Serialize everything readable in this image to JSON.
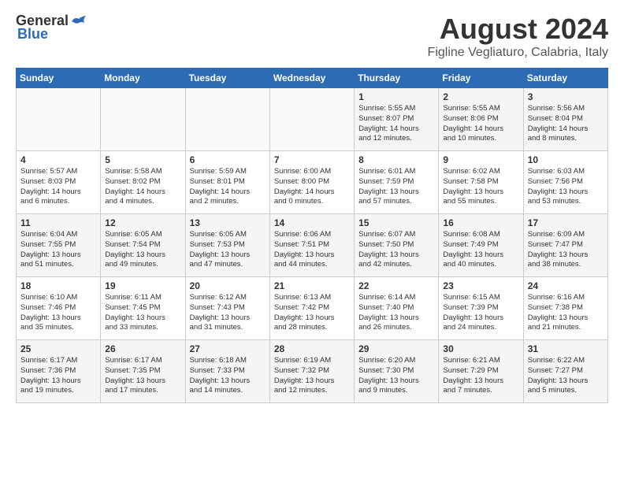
{
  "logo": {
    "general": "General",
    "blue": "Blue"
  },
  "title": "August 2024",
  "location": "Figline Vegliaturo, Calabria, Italy",
  "headers": [
    "Sunday",
    "Monday",
    "Tuesday",
    "Wednesday",
    "Thursday",
    "Friday",
    "Saturday"
  ],
  "weeks": [
    [
      {
        "day": "",
        "info": ""
      },
      {
        "day": "",
        "info": ""
      },
      {
        "day": "",
        "info": ""
      },
      {
        "day": "",
        "info": ""
      },
      {
        "day": "1",
        "info": "Sunrise: 5:55 AM\nSunset: 8:07 PM\nDaylight: 14 hours\nand 12 minutes."
      },
      {
        "day": "2",
        "info": "Sunrise: 5:55 AM\nSunset: 8:06 PM\nDaylight: 14 hours\nand 10 minutes."
      },
      {
        "day": "3",
        "info": "Sunrise: 5:56 AM\nSunset: 8:04 PM\nDaylight: 14 hours\nand 8 minutes."
      }
    ],
    [
      {
        "day": "4",
        "info": "Sunrise: 5:57 AM\nSunset: 8:03 PM\nDaylight: 14 hours\nand 6 minutes."
      },
      {
        "day": "5",
        "info": "Sunrise: 5:58 AM\nSunset: 8:02 PM\nDaylight: 14 hours\nand 4 minutes."
      },
      {
        "day": "6",
        "info": "Sunrise: 5:59 AM\nSunset: 8:01 PM\nDaylight: 14 hours\nand 2 minutes."
      },
      {
        "day": "7",
        "info": "Sunrise: 6:00 AM\nSunset: 8:00 PM\nDaylight: 14 hours\nand 0 minutes."
      },
      {
        "day": "8",
        "info": "Sunrise: 6:01 AM\nSunset: 7:59 PM\nDaylight: 13 hours\nand 57 minutes."
      },
      {
        "day": "9",
        "info": "Sunrise: 6:02 AM\nSunset: 7:58 PM\nDaylight: 13 hours\nand 55 minutes."
      },
      {
        "day": "10",
        "info": "Sunrise: 6:03 AM\nSunset: 7:56 PM\nDaylight: 13 hours\nand 53 minutes."
      }
    ],
    [
      {
        "day": "11",
        "info": "Sunrise: 6:04 AM\nSunset: 7:55 PM\nDaylight: 13 hours\nand 51 minutes."
      },
      {
        "day": "12",
        "info": "Sunrise: 6:05 AM\nSunset: 7:54 PM\nDaylight: 13 hours\nand 49 minutes."
      },
      {
        "day": "13",
        "info": "Sunrise: 6:05 AM\nSunset: 7:53 PM\nDaylight: 13 hours\nand 47 minutes."
      },
      {
        "day": "14",
        "info": "Sunrise: 6:06 AM\nSunset: 7:51 PM\nDaylight: 13 hours\nand 44 minutes."
      },
      {
        "day": "15",
        "info": "Sunrise: 6:07 AM\nSunset: 7:50 PM\nDaylight: 13 hours\nand 42 minutes."
      },
      {
        "day": "16",
        "info": "Sunrise: 6:08 AM\nSunset: 7:49 PM\nDaylight: 13 hours\nand 40 minutes."
      },
      {
        "day": "17",
        "info": "Sunrise: 6:09 AM\nSunset: 7:47 PM\nDaylight: 13 hours\nand 38 minutes."
      }
    ],
    [
      {
        "day": "18",
        "info": "Sunrise: 6:10 AM\nSunset: 7:46 PM\nDaylight: 13 hours\nand 35 minutes."
      },
      {
        "day": "19",
        "info": "Sunrise: 6:11 AM\nSunset: 7:45 PM\nDaylight: 13 hours\nand 33 minutes."
      },
      {
        "day": "20",
        "info": "Sunrise: 6:12 AM\nSunset: 7:43 PM\nDaylight: 13 hours\nand 31 minutes."
      },
      {
        "day": "21",
        "info": "Sunrise: 6:13 AM\nSunset: 7:42 PM\nDaylight: 13 hours\nand 28 minutes."
      },
      {
        "day": "22",
        "info": "Sunrise: 6:14 AM\nSunset: 7:40 PM\nDaylight: 13 hours\nand 26 minutes."
      },
      {
        "day": "23",
        "info": "Sunrise: 6:15 AM\nSunset: 7:39 PM\nDaylight: 13 hours\nand 24 minutes."
      },
      {
        "day": "24",
        "info": "Sunrise: 6:16 AM\nSunset: 7:38 PM\nDaylight: 13 hours\nand 21 minutes."
      }
    ],
    [
      {
        "day": "25",
        "info": "Sunrise: 6:17 AM\nSunset: 7:36 PM\nDaylight: 13 hours\nand 19 minutes."
      },
      {
        "day": "26",
        "info": "Sunrise: 6:17 AM\nSunset: 7:35 PM\nDaylight: 13 hours\nand 17 minutes."
      },
      {
        "day": "27",
        "info": "Sunrise: 6:18 AM\nSunset: 7:33 PM\nDaylight: 13 hours\nand 14 minutes."
      },
      {
        "day": "28",
        "info": "Sunrise: 6:19 AM\nSunset: 7:32 PM\nDaylight: 13 hours\nand 12 minutes."
      },
      {
        "day": "29",
        "info": "Sunrise: 6:20 AM\nSunset: 7:30 PM\nDaylight: 13 hours\nand 9 minutes."
      },
      {
        "day": "30",
        "info": "Sunrise: 6:21 AM\nSunset: 7:29 PM\nDaylight: 13 hours\nand 7 minutes."
      },
      {
        "day": "31",
        "info": "Sunrise: 6:22 AM\nSunset: 7:27 PM\nDaylight: 13 hours\nand 5 minutes."
      }
    ]
  ]
}
